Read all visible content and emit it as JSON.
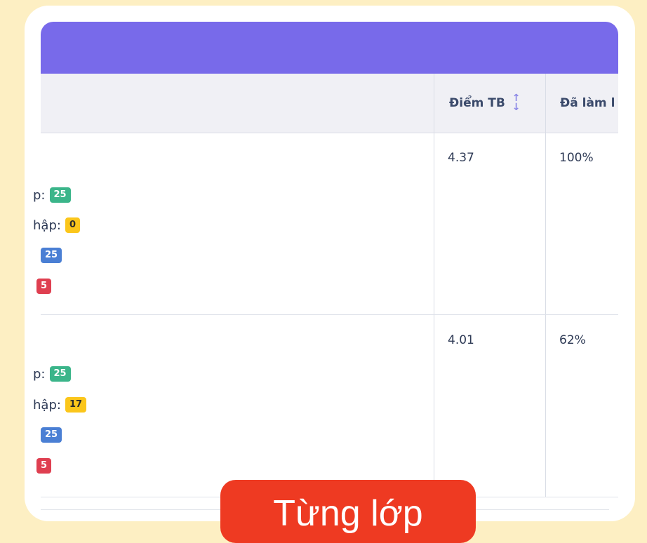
{
  "table": {
    "columns": {
      "score": "Điểm TB",
      "done": "Đã làm l"
    },
    "rows": [
      {
        "score": "4.37",
        "done": "100%",
        "stats": [
          {
            "label": "p:",
            "value": "25",
            "color": "green"
          },
          {
            "label": "hập:",
            "value": "0",
            "color": "yellow"
          },
          {
            "label": "",
            "value": "25",
            "color": "blue"
          },
          {
            "label": "",
            "value": "5",
            "color": "red"
          }
        ]
      },
      {
        "score": "4.01",
        "done": "62%",
        "stats": [
          {
            "label": "p:",
            "value": "25",
            "color": "green"
          },
          {
            "label": "hập:",
            "value": "17",
            "color": "yellow"
          },
          {
            "label": "",
            "value": "25",
            "color": "blue"
          },
          {
            "label": "",
            "value": "5",
            "color": "red"
          }
        ]
      }
    ]
  },
  "caption": "Từng lớp",
  "colors": {
    "background": "#fdefc3",
    "header": "#786aea",
    "green": "#3bb58a",
    "yellow": "#fbc61b",
    "blue": "#4a7fd4",
    "red": "#df3f50",
    "caption": "#ee3a22"
  }
}
